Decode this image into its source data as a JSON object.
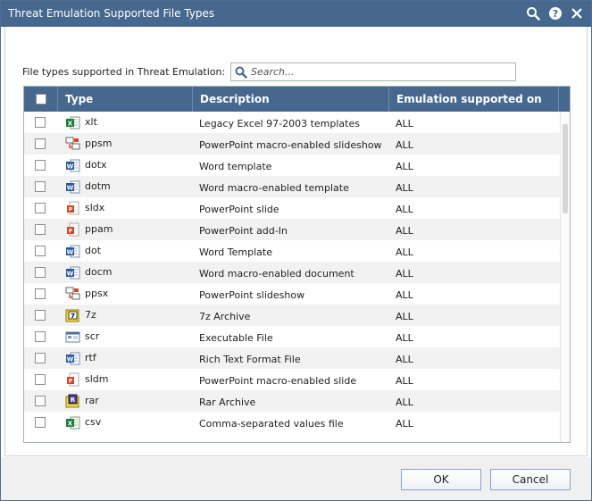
{
  "window": {
    "title": "Threat Emulation Supported File Types",
    "title_bar_color": "#46688e"
  },
  "search": {
    "label": "File types supported in Threat Emulation:",
    "placeholder": "Search..."
  },
  "table": {
    "headers": {
      "type": "Type",
      "description": "Description",
      "emulation": "Emulation supported on"
    },
    "rows": [
      {
        "icon": "excel",
        "type": "xlt",
        "description": "Legacy Excel 97-2003 templates",
        "emulation": "ALL"
      },
      {
        "icon": "powerpoint-macro",
        "type": "ppsm",
        "description": "PowerPoint macro-enabled slideshow",
        "emulation": "ALL"
      },
      {
        "icon": "word",
        "type": "dotx",
        "description": "Word template",
        "emulation": "ALL"
      },
      {
        "icon": "word",
        "type": "dotm",
        "description": "Word macro-enabled template",
        "emulation": "ALL"
      },
      {
        "icon": "powerpoint",
        "type": "sldx",
        "description": "PowerPoint slide",
        "emulation": "ALL"
      },
      {
        "icon": "powerpoint",
        "type": "ppam",
        "description": "PowerPoint add-In",
        "emulation": "ALL"
      },
      {
        "icon": "word",
        "type": "dot",
        "description": "Word Template",
        "emulation": "ALL"
      },
      {
        "icon": "word",
        "type": "docm",
        "description": "Word macro-enabled document",
        "emulation": "ALL"
      },
      {
        "icon": "powerpoint-macro",
        "type": "ppsx",
        "description": "PowerPoint slideshow",
        "emulation": "ALL"
      },
      {
        "icon": "archive-7z",
        "type": "7z",
        "description": "7z Archive",
        "emulation": "ALL"
      },
      {
        "icon": "executable",
        "type": "scr",
        "description": "Executable File",
        "emulation": "ALL"
      },
      {
        "icon": "word",
        "type": "rtf",
        "description": "Rich Text Format File",
        "emulation": "ALL"
      },
      {
        "icon": "powerpoint",
        "type": "sldm",
        "description": "PowerPoint macro-enabled slide",
        "emulation": "ALL"
      },
      {
        "icon": "archive-rar",
        "type": "rar",
        "description": "Rar Archive",
        "emulation": "ALL"
      },
      {
        "icon": "excel",
        "type": "csv",
        "description": "Comma-separated values file",
        "emulation": "ALL"
      }
    ]
  },
  "buttons": {
    "ok": "OK",
    "cancel": "Cancel"
  }
}
